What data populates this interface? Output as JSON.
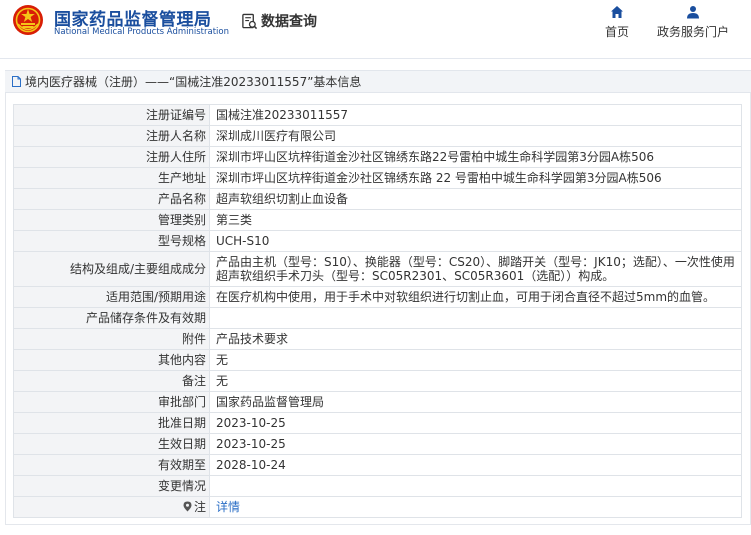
{
  "header": {
    "brand_cn": "国家药品监督管理局",
    "brand_en": "National Medical Products Administration",
    "data_query": "数据查询",
    "nav_home": "首页",
    "nav_gov": "政务服务门户"
  },
  "breadcrumb": {
    "text": "境内医疗器械（注册）——“国械注准20233011557”基本信息"
  },
  "rows": [
    {
      "label": "注册证编号",
      "value": "国械注准20233011557"
    },
    {
      "label": "注册人名称",
      "value": "深圳成川医疗有限公司"
    },
    {
      "label": "注册人住所",
      "value": "深圳市坪山区坑梓街道金沙社区锦绣东路22号雷柏中城生命科学园第3分园A栋506"
    },
    {
      "label": "生产地址",
      "value": "深圳市坪山区坑梓街道金沙社区锦绣东路 22 号雷柏中城生命科学园第3分园A栋506"
    },
    {
      "label": "产品名称",
      "value": "超声软组织切割止血设备"
    },
    {
      "label": "管理类别",
      "value": "第三类"
    },
    {
      "label": "型号规格",
      "value": "UCH-S10"
    },
    {
      "label": "结构及组成/主要组成成分",
      "value": "产品由主机（型号：S10）、换能器（型号：CS20）、脚踏开关（型号：JK10；选配）、一次性使用超声软组织手术刀头（型号：SC05R2301、SC05R3601（选配））构成。"
    },
    {
      "label": "适用范围/预期用途",
      "value": "在医疗机构中使用，用于手术中对软组织进行切割止血，可用于闭合直径不超过5mm的血管。"
    },
    {
      "label": "产品储存条件及有效期",
      "value": ""
    },
    {
      "label": "附件",
      "value": "产品技术要求"
    },
    {
      "label": "其他内容",
      "value": "无"
    },
    {
      "label": "备注",
      "value": "无"
    },
    {
      "label": "审批部门",
      "value": "国家药品监督管理局"
    },
    {
      "label": "批准日期",
      "value": "2023-10-25"
    },
    {
      "label": "生效日期",
      "value": "2023-10-25"
    },
    {
      "label": "有效期至",
      "value": "2028-10-24"
    },
    {
      "label": "变更情况",
      "value": ""
    },
    {
      "label": "注",
      "value": "详情"
    }
  ],
  "icons": {
    "logo": "national-emblem-icon",
    "data_query": "document-search-icon",
    "home": "home-icon",
    "user": "user-icon",
    "breadcrumb": "document-icon",
    "note": "map-pin-icon"
  },
  "colors": {
    "brand_blue": "#1a4e9e",
    "link_blue": "#2a6ec6",
    "label_bg": "#f3f4f6",
    "border": "#dfe3e8"
  }
}
